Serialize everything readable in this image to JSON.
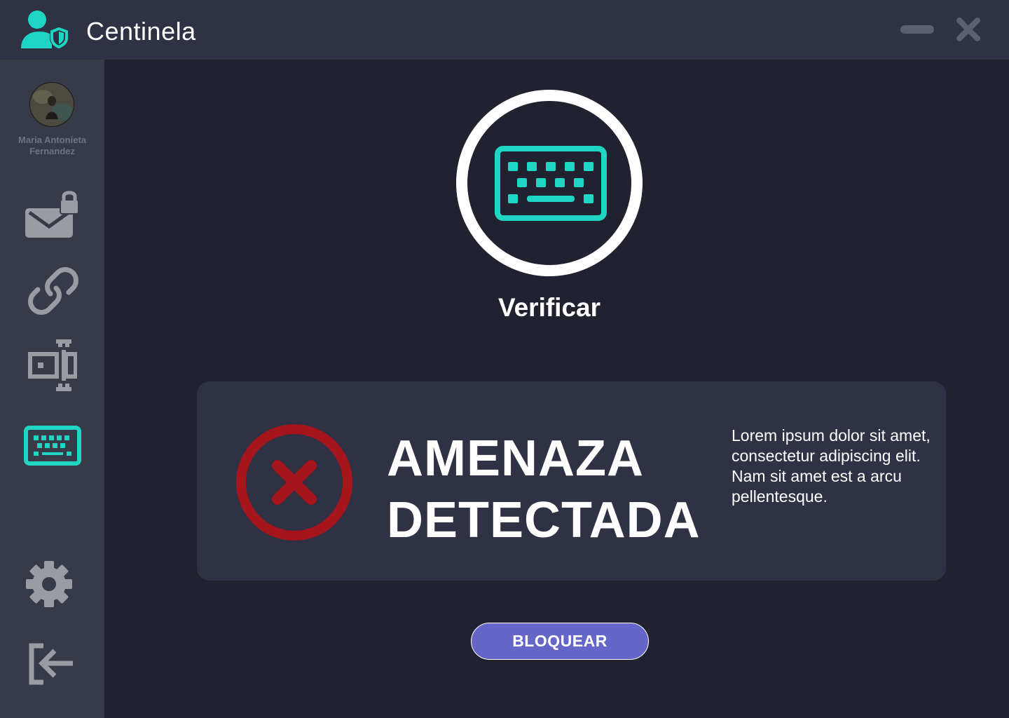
{
  "app": {
    "title": "Centinela"
  },
  "user": {
    "name": "Maria Antonieta Fernandez"
  },
  "sidebar": {
    "items": [
      {
        "icon": "mail-lock-icon",
        "active": false
      },
      {
        "icon": "link-icon",
        "active": false
      },
      {
        "icon": "text-cursor-icon",
        "active": false
      },
      {
        "icon": "keyboard-icon",
        "active": true
      },
      {
        "icon": "gear-icon",
        "active": false
      },
      {
        "icon": "logout-icon",
        "active": false
      }
    ]
  },
  "main": {
    "verify_label": "Verificar",
    "alert": {
      "title_line1": "AMENAZA",
      "title_line2": "DETECTADA",
      "description": "Lorem ipsum dolor sit amet, consectetur adipiscing elit. Nam sit amet est a arcu pellentesque."
    },
    "block_button_label": "BLOQUEAR"
  },
  "colors": {
    "accent": "#1fd6c4",
    "danger": "#a6151b",
    "button": "#6466c8",
    "icon_muted": "#9a9ca3"
  }
}
